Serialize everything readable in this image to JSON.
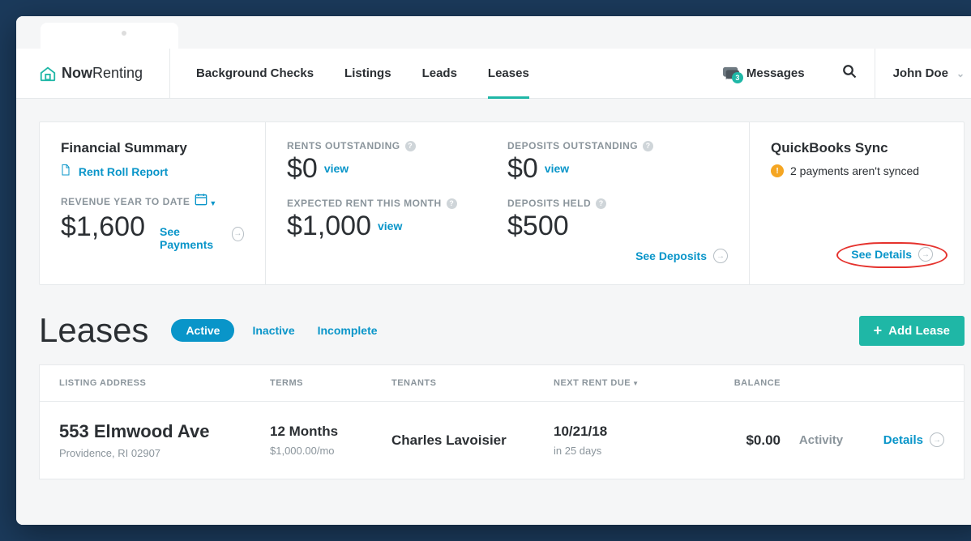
{
  "brand": {
    "name_strong": "Now",
    "name_light": "Renting"
  },
  "nav": {
    "background_checks": "Background Checks",
    "listings": "Listings",
    "leads": "Leads",
    "leases": "Leases"
  },
  "header": {
    "messages_label": "Messages",
    "messages_count": "3",
    "user_name": "John Doe"
  },
  "summary": {
    "title": "Financial Summary",
    "rent_roll_link": "Rent Roll Report",
    "revenue_label": "REVENUE YEAR TO DATE",
    "revenue_value": "$1,600",
    "see_payments": "See Payments",
    "rents_out_label": "RENTS OUTSTANDING",
    "rents_out_value": "$0",
    "expected_label": "EXPECTED RENT THIS MONTH",
    "expected_value": "$1,000",
    "deposits_out_label": "DEPOSITS OUTSTANDING",
    "deposits_out_value": "$0",
    "deposits_held_label": "DEPOSITS HELD",
    "deposits_held_value": "$500",
    "see_deposits": "See Deposits",
    "view": "view",
    "qb_title": "QuickBooks Sync",
    "qb_msg": "2 payments aren't synced",
    "see_details": "See Details"
  },
  "leases": {
    "heading": "Leases",
    "tab_active": "Active",
    "tab_inactive": "Inactive",
    "tab_incomplete": "Incomplete",
    "add_btn": "Add Lease",
    "cols": {
      "addr": "LISTING ADDRESS",
      "terms": "TERMS",
      "tenants": "TENANTS",
      "next": "NEXT RENT DUE",
      "balance": "BALANCE"
    },
    "rows": [
      {
        "address": "553 Elmwood Ave",
        "city": "Providence, RI 02907",
        "terms": "12 Months",
        "rate": "$1,000.00/mo",
        "tenant": "Charles Lavoisier",
        "next_due": "10/21/18",
        "next_rel": "in 25 days",
        "balance": "$0.00",
        "activity": "Activity",
        "details": "Details"
      }
    ]
  }
}
